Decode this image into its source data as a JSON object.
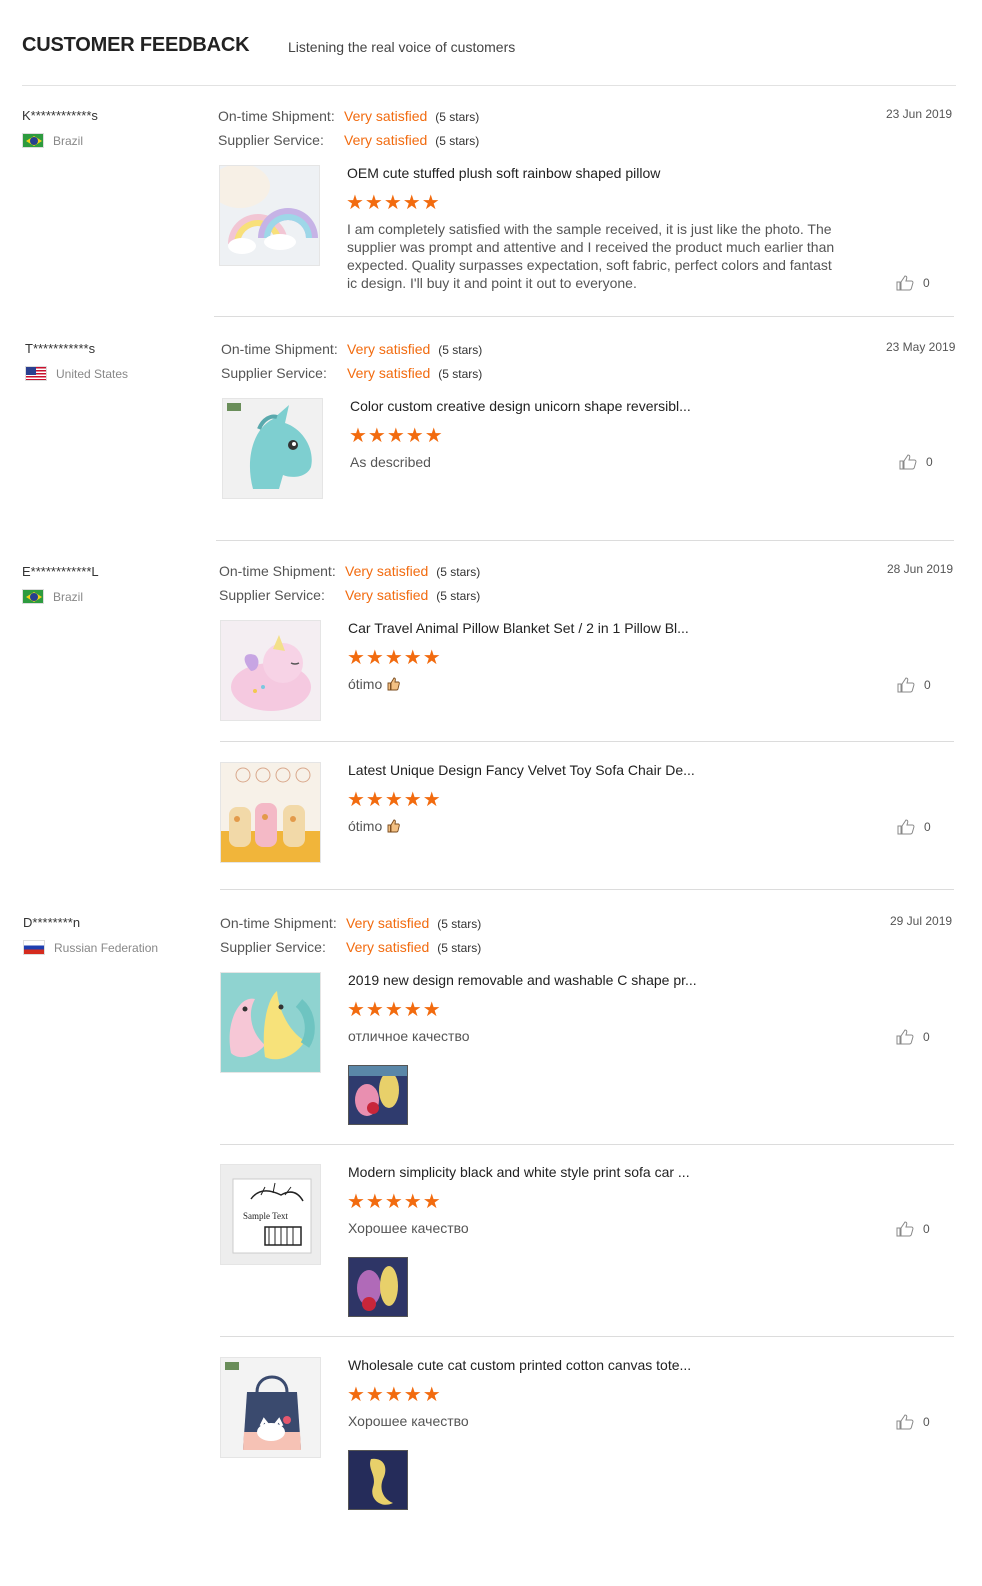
{
  "header": {
    "title": "CUSTOMER FEEDBACK",
    "subtitle": "Listening the real voice of  customers"
  },
  "labels": {
    "shipment": "On-time Shipment:",
    "service": "Supplier Service:"
  },
  "reviews": [
    {
      "name": "K************s",
      "country": "Brazil",
      "date": "23 Jun 2019",
      "shipment_value": "Very satisfied",
      "shipment_stars": "(5 stars)",
      "service_value": "Very satisfied",
      "service_stars": "(5 stars)",
      "items": [
        {
          "title": "OEM cute stuffed plush soft rainbow shaped pillow",
          "rating": 5,
          "stars": "★★★★★",
          "comment": "I am completely satisfied with the sample received, it is just like the photo. The supplier was prompt and attentive and I received the product much earlier than expected. Quality surpasses expectation, soft fabric, perfect colors and fantast ic design. I'll buy it and point it out to everyone.",
          "likes": "0"
        }
      ]
    },
    {
      "name": "T***********s",
      "country": "United States",
      "date": "23 May 2019",
      "shipment_value": "Very satisfied",
      "shipment_stars": "(5 stars)",
      "service_value": "Very satisfied",
      "service_stars": "(5 stars)",
      "items": [
        {
          "title": "Color custom creative design unicorn shape reversibl...",
          "rating": 5,
          "stars": "★★★★★",
          "comment": "As described",
          "likes": "0"
        }
      ]
    },
    {
      "name": "E************L",
      "country": "Brazil",
      "date": "28 Jun 2019",
      "shipment_value": "Very satisfied",
      "shipment_stars": "(5 stars)",
      "service_value": "Very satisfied",
      "service_stars": "(5 stars)",
      "items": [
        {
          "title": "Car Travel Animal Pillow Blanket Set / 2 in 1 Pillow Bl...",
          "rating": 5,
          "stars": "★★★★★",
          "comment": "ótimo",
          "likes": "0"
        },
        {
          "title": "Latest Unique Design Fancy Velvet Toy Sofa Chair De...",
          "rating": 5,
          "stars": "★★★★★",
          "comment": "ótimo",
          "likes": "0"
        }
      ]
    },
    {
      "name": "D********n",
      "country": "Russian Federation",
      "date": "29 Jul 2019",
      "shipment_value": "Very satisfied",
      "shipment_stars": "(5 stars)",
      "service_value": "Very satisfied",
      "service_stars": "(5 stars)",
      "items": [
        {
          "title": "2019 new design removable and washable C shape pr...",
          "rating": 5,
          "stars": "★★★★★",
          "comment": "отличное качество",
          "likes": "0"
        },
        {
          "title": "Modern simplicity black and white style print sofa car ...",
          "rating": 5,
          "stars": "★★★★★",
          "comment": "Хорошее качество",
          "likes": "0"
        },
        {
          "title": "Wholesale cute cat custom printed cotton canvas tote...",
          "rating": 5,
          "stars": "★★★★★",
          "comment": "Хорошее качество",
          "likes": "0"
        }
      ]
    }
  ],
  "colors": {
    "accent": "#f26b0f",
    "divider": "#dcdcdc"
  }
}
